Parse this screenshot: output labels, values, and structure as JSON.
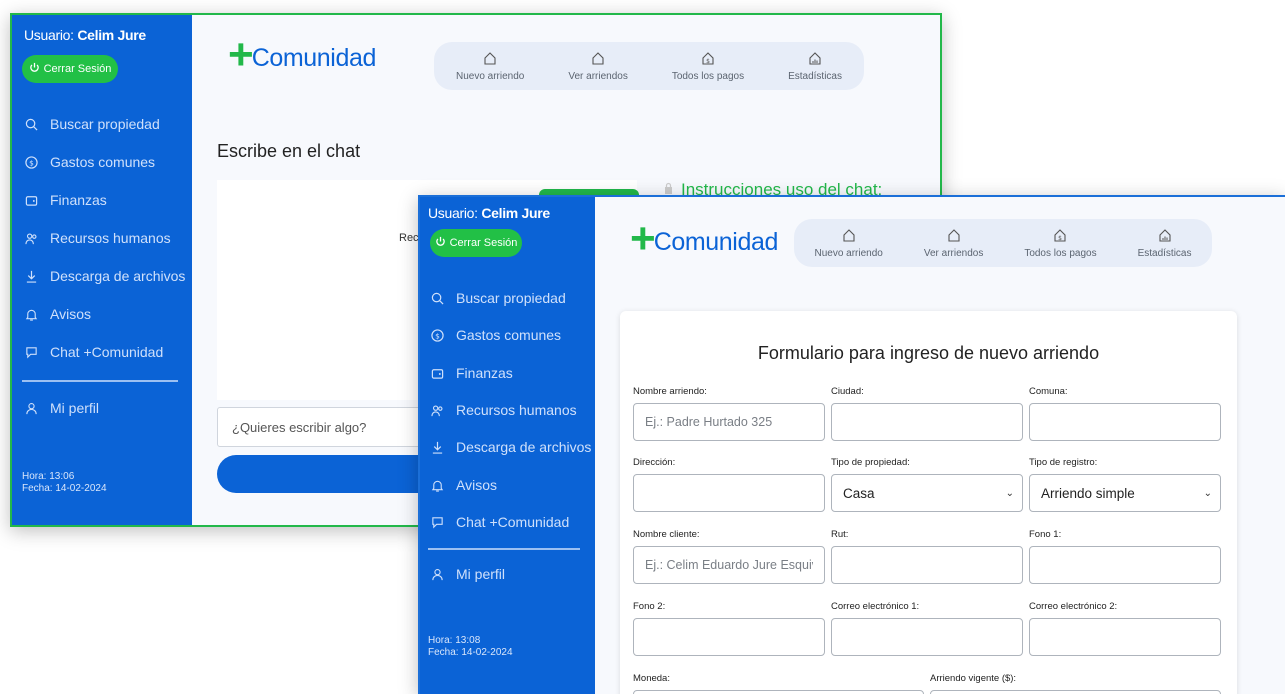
{
  "back_window": {
    "user_label": "Usuario: ",
    "user_name": "Celim Jure",
    "logout_label": "Cerrar Sesión",
    "nav": [
      {
        "label": "Buscar propiedad",
        "icon": "search-icon"
      },
      {
        "label": "Gastos comunes",
        "icon": "dollar-circle-icon"
      },
      {
        "label": "Finanzas",
        "icon": "wallet-icon"
      },
      {
        "label": "Recursos humanos",
        "icon": "people-icon"
      },
      {
        "label": "Descarga de archivos",
        "icon": "download-icon"
      },
      {
        "label": "Avisos",
        "icon": "alarm-icon"
      },
      {
        "label": "Chat +Comunidad",
        "icon": "chat-icon"
      }
    ],
    "profile_label": "Mi perfil",
    "time": "Hora: 13:06",
    "date": "Fecha: 14-02-2024",
    "logo_plus": "+",
    "logo_text": "Comunidad",
    "tabs": [
      {
        "label": "Nuevo arriendo",
        "icon": "home-icon"
      },
      {
        "label": "Ver arriendos",
        "icon": "home-icon"
      },
      {
        "label": "Todos los pagos",
        "icon": "home-dollar-icon"
      },
      {
        "label": "Estadísticas",
        "icon": "home-chart-icon"
      }
    ],
    "chat_title": "Escribe en el chat",
    "chat_partial": "Recu",
    "instructions": "Instrucciones uso del chat:",
    "chat_placeholder": "¿Quieres escribir algo?"
  },
  "front_window": {
    "user_label": "Usuario: ",
    "user_name": "Celim Jure",
    "logout_label": "Cerrar Sesión",
    "nav": [
      {
        "label": "Buscar propiedad",
        "icon": "search-icon"
      },
      {
        "label": "Gastos comunes",
        "icon": "dollar-circle-icon"
      },
      {
        "label": "Finanzas",
        "icon": "wallet-icon"
      },
      {
        "label": "Recursos humanos",
        "icon": "people-icon"
      },
      {
        "label": "Descarga de archivos",
        "icon": "download-icon"
      },
      {
        "label": "Avisos",
        "icon": "alarm-icon"
      },
      {
        "label": "Chat +Comunidad",
        "icon": "chat-icon"
      }
    ],
    "profile_label": "Mi perfil",
    "time": "Hora: 13:08",
    "date": "Fecha: 14-02-2024",
    "logo_plus": "+",
    "logo_text": "Comunidad",
    "tabs": [
      {
        "label": "Nuevo arriendo",
        "icon": "home-icon"
      },
      {
        "label": "Ver arriendos",
        "icon": "home-icon"
      },
      {
        "label": "Todos los pagos",
        "icon": "home-dollar-icon"
      },
      {
        "label": "Estadísticas",
        "icon": "home-chart-icon"
      }
    ],
    "form": {
      "title": "Formulario para ingreso de nuevo arriendo",
      "fields": {
        "nombre_arriendo": {
          "label": "Nombre arriendo:",
          "placeholder": "Ej.: Padre Hurtado 325"
        },
        "ciudad": {
          "label": "Ciudad:"
        },
        "comuna": {
          "label": "Comuna:"
        },
        "direccion": {
          "label": "Dirección:"
        },
        "tipo_propiedad": {
          "label": "Tipo de propiedad:",
          "value": "Casa"
        },
        "tipo_registro": {
          "label": "Tipo de registro:",
          "value": "Arriendo simple"
        },
        "nombre_cliente": {
          "label": "Nombre cliente:",
          "placeholder": "Ej.: Celim Eduardo Jure Esquivel"
        },
        "rut": {
          "label": "Rut:"
        },
        "fono1": {
          "label": "Fono 1:"
        },
        "fono2": {
          "label": "Fono 2:"
        },
        "correo1": {
          "label": "Correo electrónico 1:"
        },
        "correo2": {
          "label": "Correo electrónico 2:"
        },
        "moneda": {
          "label": "Moneda:"
        },
        "arriendo_vigente": {
          "label": "Arriendo vigente ($):"
        }
      }
    }
  }
}
